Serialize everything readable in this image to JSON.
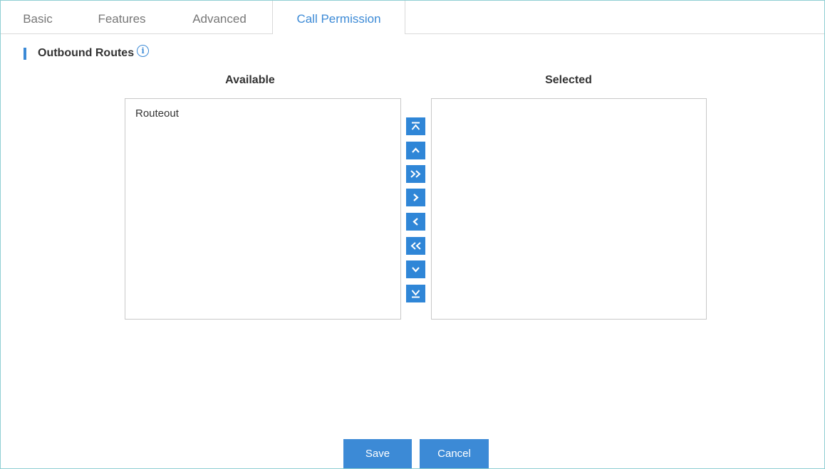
{
  "tabs": [
    {
      "label": "Basic"
    },
    {
      "label": "Features"
    },
    {
      "label": "Advanced"
    },
    {
      "label": "Call Permission",
      "active": true
    }
  ],
  "section": {
    "title": "Outbound Routes",
    "info_icon": "info-icon"
  },
  "available": {
    "header": "Available",
    "items": [
      "Routeout"
    ]
  },
  "selected": {
    "header": "Selected",
    "items": []
  },
  "controls": [
    {
      "name": "move-to-top-button",
      "icon": "move-top-icon"
    },
    {
      "name": "move-up-button",
      "icon": "chevron-up-icon"
    },
    {
      "name": "add-all-button",
      "icon": "double-chevron-right-icon"
    },
    {
      "name": "add-button",
      "icon": "chevron-right-icon"
    },
    {
      "name": "remove-button",
      "icon": "chevron-left-icon"
    },
    {
      "name": "remove-all-button",
      "icon": "double-chevron-left-icon"
    },
    {
      "name": "move-down-button",
      "icon": "chevron-down-icon"
    },
    {
      "name": "move-to-bottom-button",
      "icon": "move-bottom-icon"
    }
  ],
  "buttons": {
    "save": "Save",
    "cancel": "Cancel"
  },
  "colors": {
    "accent": "#3c8ad6",
    "control": "#2f86d7",
    "frame": "#8fcfd3"
  }
}
